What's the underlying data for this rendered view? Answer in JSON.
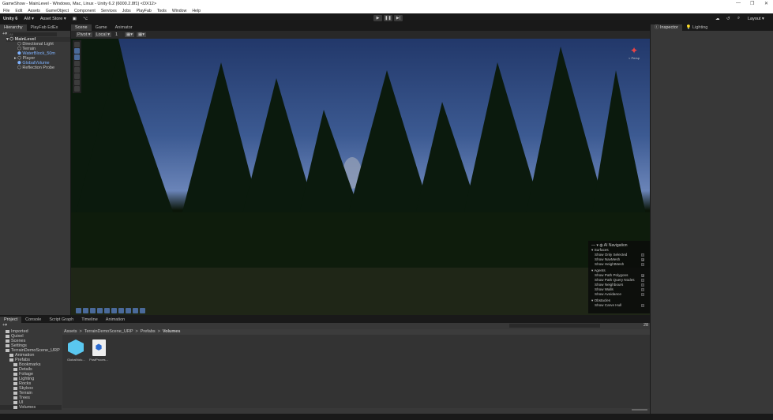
{
  "window": {
    "title": "GameShow - MainLevel - Windows, Mac, Linux - Unity 6.2 (6000.2.8f1) <DX12>",
    "min": "—",
    "max": "❐",
    "close": "✕"
  },
  "menu": [
    "File",
    "Edit",
    "Assets",
    "GameObject",
    "Component",
    "Services",
    "Jobs",
    "PlayFab",
    "Tools",
    "Window",
    "Help"
  ],
  "toolbar": {
    "unity": "Unity 6",
    "account": "AM ▾",
    "asset_store": "Asset Store ▾",
    "layout": "Layout ▾"
  },
  "hierarchy": {
    "tabs": [
      "Hierarchy",
      "PlayFab EdEx"
    ],
    "search_placeholder": "All",
    "scene": "MainLevel",
    "items": [
      {
        "label": "Directional Light",
        "prefab": false
      },
      {
        "label": "Terrain",
        "prefab": false
      },
      {
        "label": "WaterBlock_50m",
        "prefab": true
      },
      {
        "label": "Player",
        "prefab": false
      },
      {
        "label": "GlobalVolume",
        "prefab": true
      },
      {
        "label": "Reflection Probe",
        "prefab": false
      }
    ]
  },
  "scene": {
    "tabs": [
      "Scene",
      "Game",
      "Animator"
    ],
    "pivot": "Pivot ▾",
    "local": "Local ▾",
    "grid_value": "1",
    "persp": "< Persp"
  },
  "ai_nav": {
    "title": "AI Navigation",
    "sections": [
      {
        "name": "Surfaces",
        "items": [
          {
            "label": "Show Only Selected",
            "checked": false
          },
          {
            "label": "Show NavMesh",
            "checked": true
          },
          {
            "label": "Show HeightMesh",
            "checked": false
          }
        ]
      },
      {
        "name": "Agents",
        "items": [
          {
            "label": "Show Path Polygons",
            "checked": true
          },
          {
            "label": "Show Path Query Nodes",
            "checked": false
          },
          {
            "label": "Show Neighbours",
            "checked": false
          },
          {
            "label": "Show Walls",
            "checked": false
          },
          {
            "label": "Show Avoidance",
            "checked": false
          }
        ]
      },
      {
        "name": "Obstacles",
        "items": [
          {
            "label": "Show Carve Hull",
            "checked": false
          }
        ]
      }
    ]
  },
  "inspector": {
    "tabs": [
      "Inspector",
      "Lighting"
    ]
  },
  "bottom": {
    "tabs": [
      "Project",
      "Console",
      "Script Graph",
      "Timeline",
      "Animation"
    ],
    "breadcrumb": [
      "Assets",
      "TerrainDemoScene_URP",
      "Prefabs",
      "Volumes"
    ],
    "hidden_count": "28",
    "tree": [
      {
        "label": "Imported",
        "depth": 1
      },
      {
        "label": "Quixel",
        "depth": 1
      },
      {
        "label": "Scenes",
        "depth": 1
      },
      {
        "label": "Settings",
        "depth": 1
      },
      {
        "label": "TerrainDemoScene_URP",
        "depth": 1
      },
      {
        "label": "Animation",
        "depth": 2
      },
      {
        "label": "Prefabs",
        "depth": 2
      },
      {
        "label": "Bookmarks",
        "depth": 3
      },
      {
        "label": "Details",
        "depth": 3
      },
      {
        "label": "Foliage",
        "depth": 3
      },
      {
        "label": "Lighting",
        "depth": 3
      },
      {
        "label": "Rocks",
        "depth": 3
      },
      {
        "label": "Skybox",
        "depth": 3
      },
      {
        "label": "Terrain",
        "depth": 3
      },
      {
        "label": "Trees",
        "depth": 3
      },
      {
        "label": "UI",
        "depth": 3
      },
      {
        "label": "Volumes",
        "depth": 3
      }
    ],
    "assets": [
      "GlobalVolu...",
      "PostProces..."
    ]
  }
}
